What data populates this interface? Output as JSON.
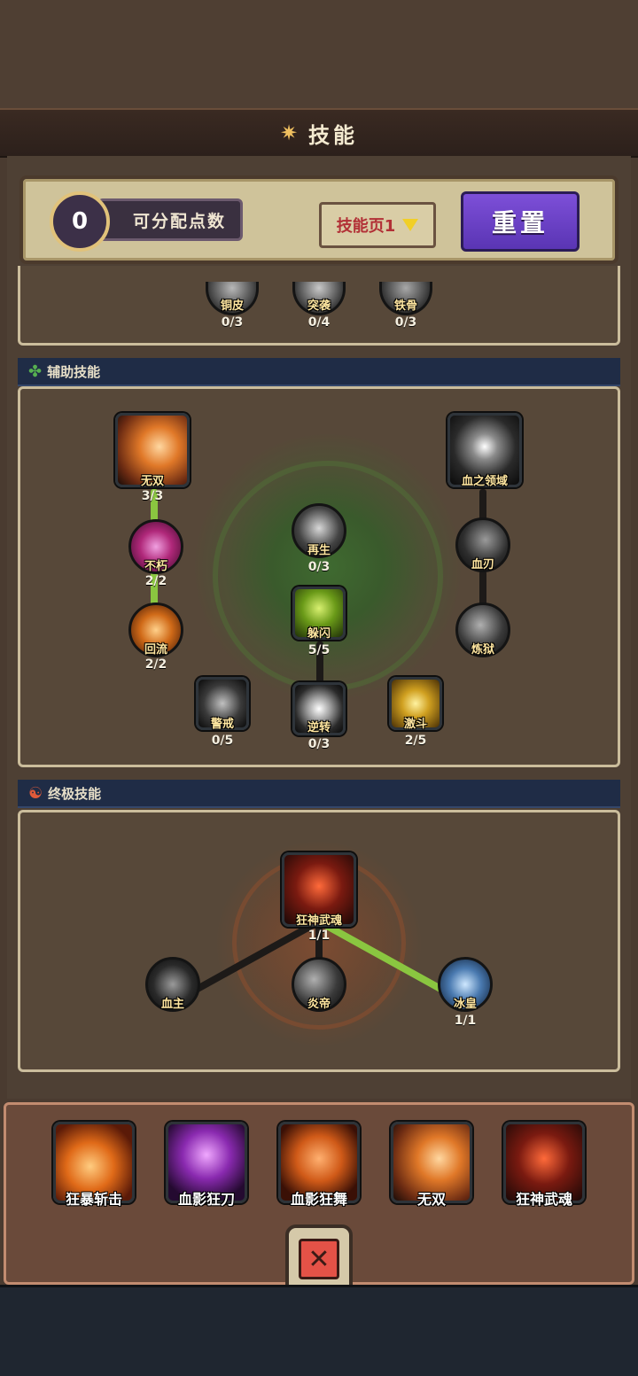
{
  "title": {
    "label": "技能",
    "icon": "sun-icon"
  },
  "points": {
    "value": "0",
    "label": "可分配点数"
  },
  "page_select": {
    "label": "技能页1",
    "icon": "triangle-down-icon"
  },
  "reset_label": "重置",
  "basic_partial": [
    {
      "name": "铜皮",
      "level": "0/3"
    },
    {
      "name": "突袭",
      "level": "0/4"
    },
    {
      "name": "铁骨",
      "level": "0/3"
    }
  ],
  "support": {
    "header": "辅助技能",
    "icon": "clover-icon",
    "skills": {
      "wushuang": {
        "name": "无双",
        "level": "3/3"
      },
      "buxiu": {
        "name": "不朽",
        "level": "2/2"
      },
      "huiliu": {
        "name": "回流",
        "level": "2/2"
      },
      "jingjie": {
        "name": "警戒",
        "level": "0/5"
      },
      "zaisheng": {
        "name": "再生",
        "level": "0/3"
      },
      "duoshan": {
        "name": "躲闪",
        "level": "5/5"
      },
      "nizhuan": {
        "name": "逆转",
        "level": "0/3"
      },
      "jidou": {
        "name": "激斗",
        "level": "2/5"
      },
      "xuezhilingyu": {
        "name": "血之领域",
        "level": ""
      },
      "xuedao": {
        "name": "血刃",
        "level": ""
      },
      "lianyu": {
        "name": "炼狱",
        "level": ""
      }
    }
  },
  "ultimate": {
    "header": "终极技能",
    "icon": "yin-yang-icon",
    "skills": {
      "kuangshen": {
        "name": "狂神武魂",
        "level": "1/1"
      },
      "xuezhu": {
        "name": "血主",
        "level": ""
      },
      "yandi": {
        "name": "炎帝",
        "level": ""
      },
      "binghuang": {
        "name": "冰皇",
        "level": "1/1"
      }
    }
  },
  "equipped": [
    {
      "name": "狂暴斩击"
    },
    {
      "name": "血影狂刀"
    },
    {
      "name": "血影狂舞"
    },
    {
      "name": "无双"
    },
    {
      "name": "狂神武魂"
    }
  ],
  "close_icon": "close-x-icon",
  "colors": {
    "accent_purple": "#6a42c8",
    "link_green": "#8ac640",
    "header_blue": "#1f2c46"
  }
}
